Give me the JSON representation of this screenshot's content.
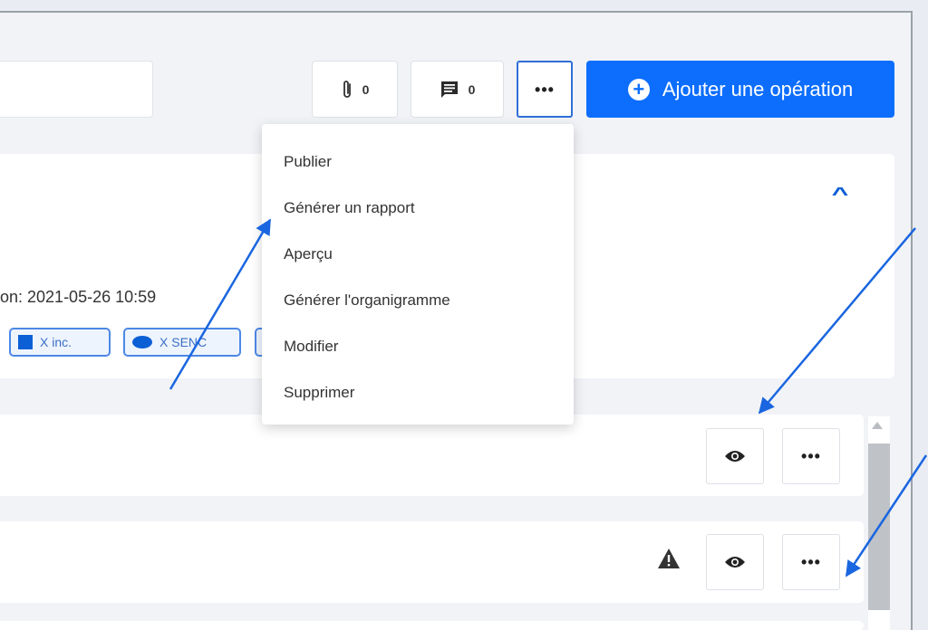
{
  "toolbar": {
    "attachments_count": "0",
    "comments_count": "0",
    "more_label": "•••",
    "add_operation_label": "Ajouter une opération"
  },
  "dropdown": {
    "items": [
      {
        "label": "Publier"
      },
      {
        "label": "Générer un rapport"
      },
      {
        "label": "Aperçu"
      },
      {
        "label": "Générer l'organigramme"
      },
      {
        "label": "Modifier"
      },
      {
        "label": "Supprimer"
      }
    ]
  },
  "card": {
    "date_text": "on: 2021-05-26 10:59",
    "tags": [
      {
        "label": "X inc."
      },
      {
        "label": "X SENC"
      }
    ]
  },
  "rows": [
    {
      "more_label": "•••"
    },
    {
      "more_label": "•••"
    }
  ],
  "colors": {
    "primary": "#0d6efd",
    "annotation_arrow": "#1a66e0",
    "warning": "#333333"
  },
  "icons": {
    "attachment": "paperclip-icon",
    "comment": "comment-icon",
    "add": "plus-circle-icon",
    "collapse": "chevron-up-icon",
    "view": "eye-icon",
    "warning": "warning-triangle-icon"
  }
}
